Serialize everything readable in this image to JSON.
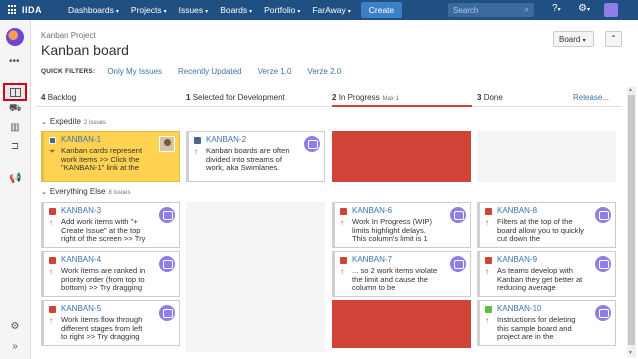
{
  "topbar": {
    "logo": "IIDA",
    "menu": [
      {
        "label": "Dashboards"
      },
      {
        "label": "Projects"
      },
      {
        "label": "Issues"
      },
      {
        "label": "Boards"
      },
      {
        "label": "Portfolio"
      },
      {
        "label": "FarAway"
      }
    ],
    "create_label": "Create",
    "search_placeholder": "Search",
    "help_icon": "help-icon",
    "settings_icon": "gear-icon"
  },
  "sidebar": {
    "more": "•••",
    "icons": [
      "board-icon",
      "releases-icon",
      "reports-icon",
      "issues-icon",
      "announce-icon",
      "settings-icon",
      "collapse-icon"
    ]
  },
  "header": {
    "project": "Kanban Project",
    "title": "Kanban board",
    "board_button": "Board",
    "quick_filters_label": "QUICK FILTERS:",
    "quick_filters": [
      "Only My Issues",
      "Recently Updated",
      "Verze 1.0",
      "Verze 2.0"
    ]
  },
  "columns": [
    {
      "count": "4",
      "name": "Backlog",
      "max": ""
    },
    {
      "count": "1",
      "name": "Selected for Development",
      "max": ""
    },
    {
      "count": "2",
      "name": "In Progress",
      "max": "Max 1"
    },
    {
      "count": "3",
      "name": "Done",
      "max": ""
    }
  ],
  "release_label": "Release...",
  "swimlanes": [
    {
      "name": "Expedite",
      "count": "2 issues"
    },
    {
      "name": "Everything Else",
      "count": "8 issues"
    }
  ],
  "cards": {
    "k1": {
      "key": "KANBAN-1",
      "summary": "Kanban cards represent work items >> Click the \"KANBAN-1\" link at the"
    },
    "k2": {
      "key": "KANBAN-2",
      "summary": "Kanban boards are often divided into streams of work, aka Swimlanes."
    },
    "k3": {
      "key": "KANBAN-3",
      "summary": "Add work items with \"+ Create Issue\" at the top right of the screen >> Try"
    },
    "k4": {
      "key": "KANBAN-4",
      "summary": "Work items are ranked in priority order (from top to bottom) >> Try dragging"
    },
    "k5": {
      "key": "KANBAN-5",
      "summary": "Work items flow through different stages from left to right >> Try dragging"
    },
    "k6": {
      "key": "KANBAN-6",
      "summary": "Work In Progress (WIP) limits highlight delays. This column's limit is 1"
    },
    "k7": {
      "key": "KANBAN-7",
      "summary": "... so 2 work items violate the limit and cause the column to be"
    },
    "k8": {
      "key": "KANBAN-8",
      "summary": "Filters at the top of the board allow you to quickly cut down the"
    },
    "k9": {
      "key": "KANBAN-9",
      "summary": "As teams develop with Kanban they get better at reducing average"
    },
    "k10": {
      "key": "KANBAN-10",
      "summary": "Instructions for deleting this sample board and project are in the"
    }
  },
  "colors": {
    "nav": "#205081",
    "link": "#3b73af",
    "red": "#d04437",
    "yellow": "#ffd351",
    "avatar": "#8f7ee7"
  }
}
